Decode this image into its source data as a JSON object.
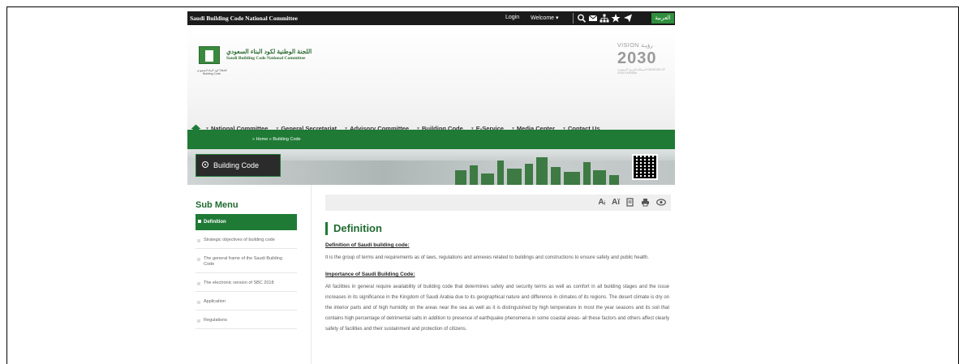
{
  "topbar": {
    "site_name": "Saudi Building Code National Committee",
    "login": "Login",
    "welcome": "Welcome ▾",
    "language": "العربية",
    "icons": [
      "search-icon",
      "mail-icon",
      "sitemap-icon",
      "star-icon",
      "send-icon"
    ]
  },
  "header": {
    "org_name_ar": "اللجنة الوطنية لكود البناء السعودي",
    "org_name_en": "Saudi Building Code National Committee",
    "logo_caption": "كود البناء السعودي Saudi Building Code",
    "vision_top": "VISION رؤيـة",
    "vision_year": "2030",
    "vision_sub": "المملكة العربية السعودية KINGDOM OF SAUDI ARABIA"
  },
  "nav": {
    "items": [
      "National Committee",
      "General Secretariat",
      "Advisory Committee",
      "Building Code",
      "E-Service",
      "Media Center",
      "Contact Us"
    ]
  },
  "breadcrumb": "» Home  » Building Code",
  "banner": {
    "label": "Building Code"
  },
  "sidebar": {
    "title": "Sub Menu",
    "active": "Definition",
    "items": [
      "Strategic objectives of building code",
      "The general frame of the Saudi Building Code",
      "The electronic version of SBC 2018",
      "Application",
      "Regulations"
    ]
  },
  "toolbar": {
    "tools": [
      "A+",
      "A-",
      "print-preview",
      "print",
      "view"
    ]
  },
  "content": {
    "title": "Definition",
    "heading1": "Definition of Saudi building code:",
    "para1": "It is the group of terms and requirements as of laws, regulations and annexes related to buildings and constructions to ensure safety and public health.",
    "heading2": "Importance of Saudi Building Code:",
    "para2": "All facilities in general require availability of building code that determines safety and security terms as well as comfort in all building stages and the issue increases in its significance in the Kingdom of Saudi Arabia due to its geographical nature and difference in climates of its regions. The desert climate is dry on the interior parts and of high humidity on the areas near the sea as well as it is distinguished by high temperature in most the year seasons and its soil that contains high percentage of detrimental salts in addition to presence of earthquake phenomena in some coastal areas- all these factors and others affect clearly safety of facilities and their sustainment and protection of citizens."
  },
  "colors": {
    "brand_green": "#1f7a35",
    "topbar": "#1b1b1b"
  }
}
